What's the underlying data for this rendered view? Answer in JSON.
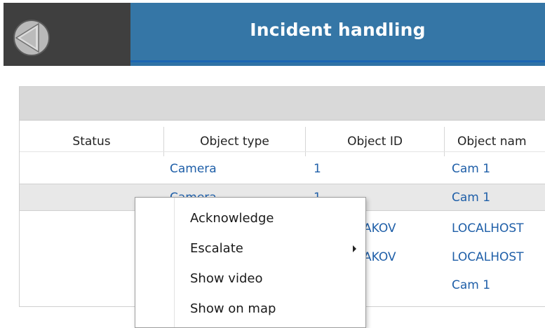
{
  "header": {
    "title": "Incident handling",
    "logo_icon": "app-logo-icon"
  },
  "table": {
    "columns": [
      "Status",
      "Object type",
      "Object ID",
      "Object nam"
    ],
    "rows": [
      {
        "status": "",
        "object_type": "Camera",
        "object_id": "1",
        "object_name": "Cam 1"
      },
      {
        "status": "",
        "object_type": "Camera",
        "object_id": "1",
        "object_name": "Cam 1"
      },
      {
        "status": "",
        "object_type": "",
        "object_id": "AKOV",
        "object_name": "LOCALHOST"
      },
      {
        "status": "",
        "object_type": "",
        "object_id": "AKOV",
        "object_name": "LOCALHOST"
      },
      {
        "status": "",
        "object_type": "",
        "object_id": "",
        "object_name": "Cam 1"
      }
    ]
  },
  "context_menu": {
    "items": [
      "Acknowledge",
      "Escalate",
      "Show video",
      "Show on map"
    ],
    "submenu_icon": "chevron-right-icon"
  },
  "colors": {
    "header_blue": "#3576a6",
    "logo_bg": "#3f3f3f",
    "link_blue": "#1f5fa8",
    "selected_row": "#e8e8e8"
  }
}
